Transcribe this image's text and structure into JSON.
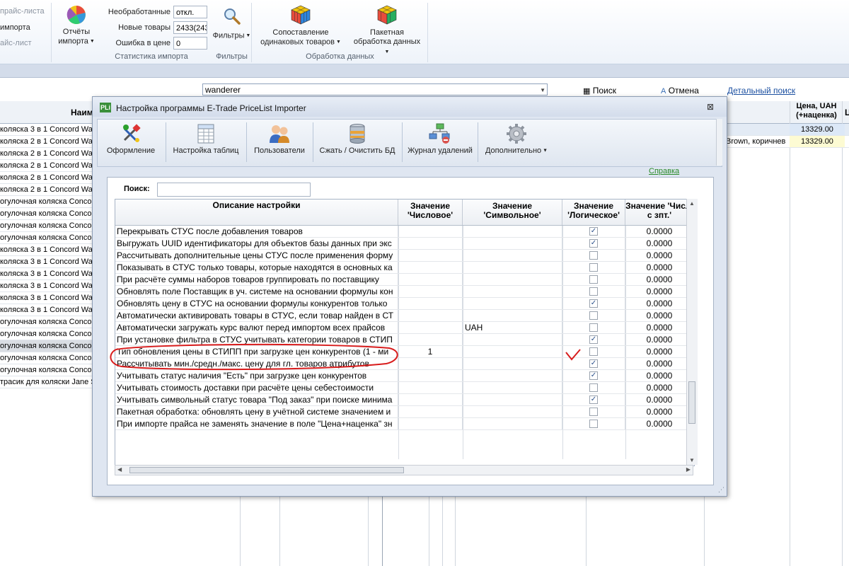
{
  "ribbon": {
    "left_items": [
      "прайс-листа",
      "импорта",
      "айс-лист"
    ],
    "reports": {
      "label_line1": "Отчёты",
      "label_line2": "импорта"
    },
    "stats": {
      "rows": [
        {
          "label": "Необработанные",
          "value": "откл."
        },
        {
          "label": "Новые товары",
          "value": "2433(243"
        },
        {
          "label": "Ошибка в цене",
          "value": "0"
        }
      ],
      "group_title": "Статистика импорта"
    },
    "filters": {
      "label": "Фильтры",
      "group_title": "Фильтры"
    },
    "data_processing": {
      "compare": {
        "line1": "Сопоставление",
        "line2": "одинаковых товаров"
      },
      "batch": {
        "line1": "Пакетная",
        "line2": "обработка данных"
      },
      "group_title": "Обработка данных"
    }
  },
  "toolbar_bg": {
    "search_value": "wanderer",
    "search_button": "Поиск",
    "cancel_button": "Отмена",
    "detailed_search": "Детальный поиск"
  },
  "bg_table": {
    "col_name": "Наим",
    "col_price": "Цена, UAH (+наценка)",
    "col_extra": "Ц",
    "rows": [
      "коляска 3 в 1 Concord Wande",
      "коляска 2 в 1 Concord Wande",
      "коляска 2 в 1 Concord Wande",
      "коляска 2 в 1 Concord Wande",
      "коляска 2 в 1 Concord Wande",
      "коляска 2 в 1 Concord Wande",
      "огулочная коляска Concor",
      "огулочная коляска Concor",
      "огулочная коляска Concor",
      "огулочная коляска Concor",
      "коляска 3 в 1 Concord Wande",
      "коляска 3 в 1 Concord Wande",
      "коляска 3 в 1 Concord Wande",
      "коляска 3 в 1 Concord Wande",
      "коляска 3 в 1 Concord Wande",
      "коляска 3 в 1 Concord Wande",
      "огулочная коляска Concor",
      "огулочная коляска Concor",
      "огулочная коляска Concor",
      "огулочная коляска Concor",
      "огулочная коляска Concor",
      "трасик для коляски Jane S"
    ],
    "right_rows": [
      {
        "text": "",
        "price": "13329.00"
      },
      {
        "text": "Brown, коричнев",
        "price": "13329.00"
      }
    ]
  },
  "dialog": {
    "title": "Настройка программы E-Trade PriceList Importer",
    "toolbar": [
      {
        "label": "Оформление",
        "icon": "paint-tools-icon"
      },
      {
        "label": "Настройка таблиц",
        "icon": "table-settings-icon"
      },
      {
        "label": "Пользователи",
        "icon": "users-icon"
      },
      {
        "label": "Сжать / Очистить БД",
        "icon": "database-icon"
      },
      {
        "label": "Журнал удалений",
        "icon": "deletion-log-icon"
      },
      {
        "label": "Дополнительно",
        "icon": "gear-icon"
      }
    ],
    "help_link": "Справка",
    "search_label": "Поиск:",
    "search_value": "",
    "columns": {
      "desc": "Описание настройки",
      "num": "Значение 'Числовое'",
      "sym": "Значение 'Символьное'",
      "log": "Значение 'Логическое'",
      "dec": "Значение 'Числ. с зпт.'"
    },
    "rows": [
      {
        "desc": "Перекрывать СТУС после добавления товаров",
        "num": "",
        "sym": "",
        "checked": true,
        "dec": "0.0000"
      },
      {
        "desc": "Выгружать UUID идентификаторы для объектов базы данных при экс",
        "num": "",
        "sym": "",
        "checked": true,
        "dec": "0.0000"
      },
      {
        "desc": "Рассчитывать дополнительные цены СТУС после применения форму",
        "num": "",
        "sym": "",
        "checked": false,
        "dec": "0.0000"
      },
      {
        "desc": "Показывать в СТУС только товары, которые находятся в основных ка",
        "num": "",
        "sym": "",
        "checked": false,
        "dec": "0.0000"
      },
      {
        "desc": "При расчёте суммы наборов товаров группировать по поставщику",
        "num": "",
        "sym": "",
        "checked": false,
        "dec": "0.0000"
      },
      {
        "desc": "Обновлять поле Поставщик в уч. системе на основании формулы кон",
        "num": "",
        "sym": "",
        "checked": false,
        "dec": "0.0000"
      },
      {
        "desc": "Обновлять цену в СТУС на основании формулы конкурентов только",
        "num": "",
        "sym": "",
        "checked": true,
        "dec": "0.0000"
      },
      {
        "desc": "Автоматически активировать товары в СТУС, если товар найден в СТ",
        "num": "",
        "sym": "",
        "checked": false,
        "dec": "0.0000"
      },
      {
        "desc": "Автоматически загружать курс валют перед импортом всех прайсов",
        "num": "",
        "sym": "UAH",
        "checked": false,
        "dec": "0.0000"
      },
      {
        "desc": "При установке фильтра в СТУС учитывать категории товаров в СТИП",
        "num": "",
        "sym": "",
        "checked": true,
        "dec": "0.0000"
      },
      {
        "desc": "Тип обновления цены в СТИПП при загрузке цен конкурентов (1 - ми",
        "num": "1",
        "sym": "",
        "checked": false,
        "dec": "0.0000"
      },
      {
        "desc": "Рассчитывать мин./средн./макс. цену для гл. товаров атрибутов",
        "num": "",
        "sym": "",
        "checked": true,
        "dec": "0.0000"
      },
      {
        "desc": "Учитывать статус наличия \"Есть\" при загрузке цен конкурентов",
        "num": "",
        "sym": "",
        "checked": true,
        "dec": "0.0000"
      },
      {
        "desc": "Учитывать стоимость доставки при расчёте цены себестоимости",
        "num": "",
        "sym": "",
        "checked": false,
        "dec": "0.0000"
      },
      {
        "desc": "Учитывать символьный статус товара \"Под заказ\" при поиске минима",
        "num": "",
        "sym": "",
        "checked": true,
        "dec": "0.0000"
      },
      {
        "desc": "Пакетная обработка: обновлять цену в учётной системе значением и",
        "num": "",
        "sym": "",
        "checked": false,
        "dec": "0.0000"
      },
      {
        "desc": "При импорте прайса не заменять значение в поле \"Цена+наценка\" зн",
        "num": "",
        "sym": "",
        "checked": false,
        "dec": "0.0000"
      }
    ]
  },
  "colors": {
    "accent": "#1b4fa0",
    "annotation": "#d81c1c",
    "help": "#2a8a2a"
  }
}
